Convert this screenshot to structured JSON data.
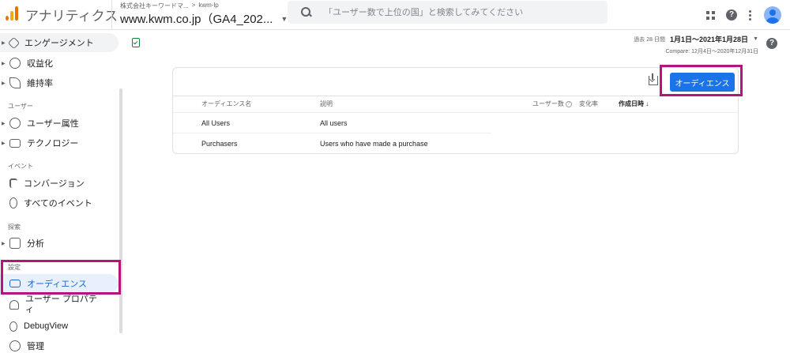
{
  "header": {
    "app_title": "アナリティクス",
    "breadcrumb": [
      "株式会社キーワードマ...",
      ">",
      "kwm-lp"
    ],
    "property_name": "www.kwm.co.jp（GA4_202...",
    "search_placeholder": "「ユーザー数で上位の国」と検索してみてください"
  },
  "sidebar": {
    "items_top": [
      {
        "label": "エンゲージメント",
        "icon": "engagement-icon"
      },
      {
        "label": "収益化",
        "icon": "monetization-icon"
      },
      {
        "label": "維持率",
        "icon": "retention-icon"
      }
    ],
    "sections": {
      "user": "ユーザー",
      "event": "イベント",
      "explore": "探索",
      "settings": "設定"
    },
    "user_items": [
      {
        "label": "ユーザー属性",
        "icon": "globe-icon"
      },
      {
        "label": "テクノロジー",
        "icon": "devices-icon"
      }
    ],
    "event_items": [
      {
        "label": "コンバージョン",
        "icon": "flag-icon"
      },
      {
        "label": "すべてのイベント",
        "icon": "touch-icon"
      }
    ],
    "explore_items": [
      {
        "label": "分析",
        "icon": "analysis-icon"
      }
    ],
    "settings_items": [
      {
        "label": "オーディエンス",
        "icon": "audience-icon",
        "active": true
      },
      {
        "label": "ユーザー プロパテ\nィ",
        "icon": "user-property-icon"
      },
      {
        "label": "DebugView",
        "icon": "debug-icon"
      }
    ],
    "admin": {
      "label": "管理",
      "icon": "gear-icon"
    }
  },
  "main": {
    "date_range": {
      "label": "過去 28 日間",
      "value": "1月1日～2021年1月28日",
      "compare": "Compare: 12月4日～2020年12月31日"
    },
    "card": {
      "button_label": "オーディエンス",
      "columns": [
        "オーディエンス名",
        "説明",
        "ユーザー数",
        "変化率",
        "作成日時"
      ],
      "sorted_column_arrow": "↓",
      "rows": [
        {
          "name": "All Users",
          "description": "All users"
        },
        {
          "name": "Purchasers",
          "description": "Users who have made a purchase"
        }
      ]
    }
  },
  "colors": {
    "accent": "#1a73e8",
    "highlight_box": "#b5157b",
    "active_bg": "#e8f0fe"
  }
}
